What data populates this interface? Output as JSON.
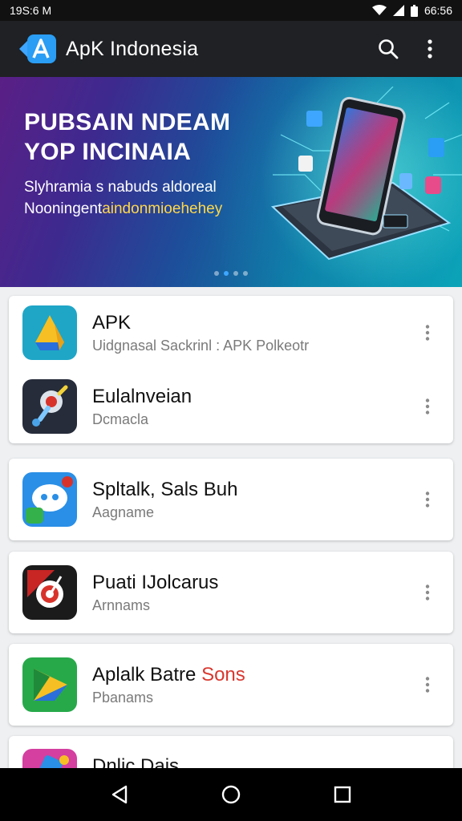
{
  "status_bar": {
    "time_left": "19S:6 M",
    "time_right": "66:56"
  },
  "app_bar": {
    "title": "ApK Indonesia",
    "logo_letters": "A"
  },
  "banner": {
    "headline_line1": "PUBSAIN NDEAM",
    "headline_line2": "YOP INCINAIA",
    "sub_line1": "Slyhramia s nabuds aldoreal",
    "sub_line2_prefix": "Nooningent",
    "sub_line2_highlight": "aindonmioehehey",
    "dots_total": 4,
    "dots_active": 2
  },
  "cards": [
    {
      "items": [
        {
          "name": "APK",
          "subtitle": "Uidgnasal Sackrinl : APK Polkeotr",
          "icon": "drive-triangle-icon"
        },
        {
          "name": "Eulalnveian",
          "subtitle": "Dcmacla",
          "icon": "joystick-icon"
        }
      ]
    },
    {
      "items": [
        {
          "name": "Spltalk, Sals Buh",
          "subtitle": "Aagname",
          "icon": "chat-bubble-icon"
        }
      ]
    },
    {
      "items": [
        {
          "name": "Puati IJolcarus",
          "subtitle": "Arnnams",
          "icon": "target-icon"
        }
      ]
    },
    {
      "items": [
        {
          "name_prefix": "Aplalk Batre",
          "name_highlight": "Sons",
          "subtitle": "Pbanams",
          "icon": "drive-green-icon"
        }
      ]
    },
    {
      "items": [
        {
          "name": "Dnlic Dais",
          "icon": "pen-icon"
        }
      ]
    }
  ],
  "colors": {
    "accent": "#3ea6ff",
    "app_bar": "#1f2124",
    "highlight_red": "#d9382f",
    "highlight_yellow": "#ffd84a"
  }
}
